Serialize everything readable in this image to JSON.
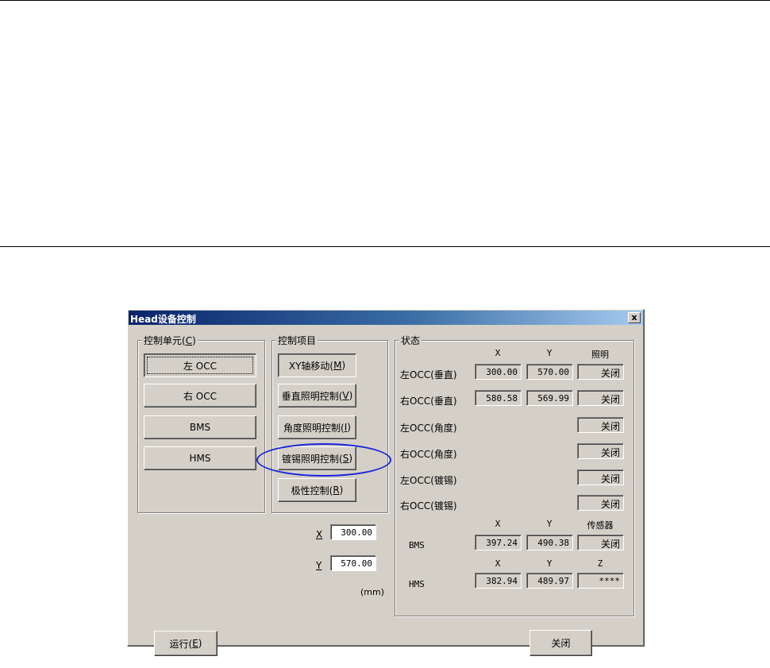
{
  "dialog": {
    "title": "Head设备控制",
    "close_label": "x"
  },
  "control_unit": {
    "legend": "控制单元(",
    "legend_key": "C",
    "legend_end": ")",
    "buttons": [
      "左 OCC",
      "右 OCC",
      "BMS",
      "HMS"
    ]
  },
  "control_items": {
    "legend": "控制项目",
    "buttons": [
      {
        "label": "XY轴移动(",
        "key": "M",
        "end": ")"
      },
      {
        "label": "垂直照明控制(",
        "key": "V",
        "end": ")"
      },
      {
        "label": "角度照明控制(",
        "key": "I",
        "end": ")"
      },
      {
        "label": "镀锡照明控制(",
        "key": "S",
        "end": ")"
      },
      {
        "label": "极性控制(",
        "key": "R",
        "end": ")"
      }
    ]
  },
  "coords": {
    "x_label": "X",
    "x_value": "300.00",
    "y_label": "Y",
    "y_value": "570.00",
    "unit": "(mm)"
  },
  "status": {
    "legend": "状态",
    "headers_occ": [
      "X",
      "Y",
      "照明"
    ],
    "rows_occ": [
      {
        "label": "左OCC(垂直)",
        "x": "300.00",
        "y": "570.00",
        "light": "关闭"
      },
      {
        "label": "右OCC(垂直)",
        "x": "580.58",
        "y": "569.99",
        "light": "关闭"
      },
      {
        "label": "左OCC(角度)",
        "light": "关闭"
      },
      {
        "label": "右OCC(角度)",
        "light": "关闭"
      },
      {
        "label": "左OCC(镀锡)",
        "light": "关闭"
      },
      {
        "label": "右OCC(镀锡)",
        "light": "关闭"
      }
    ],
    "headers_bms": [
      "X",
      "Y",
      "传感器"
    ],
    "bms": {
      "label": "BMS",
      "x": "397.24",
      "y": "490.38",
      "sensor": "关闭"
    },
    "headers_hms": [
      "X",
      "Y",
      "Z"
    ],
    "hms": {
      "label": "HMS",
      "x": "382.94",
      "y": "489.97",
      "z": "****"
    }
  },
  "footer": {
    "run_label": "运行(",
    "run_key": "E",
    "run_end": ")",
    "close_label": "关闭"
  },
  "colors": {
    "annotation": "#1a24d8",
    "title_start": "#0a246a",
    "face": "#d4d0c8"
  }
}
